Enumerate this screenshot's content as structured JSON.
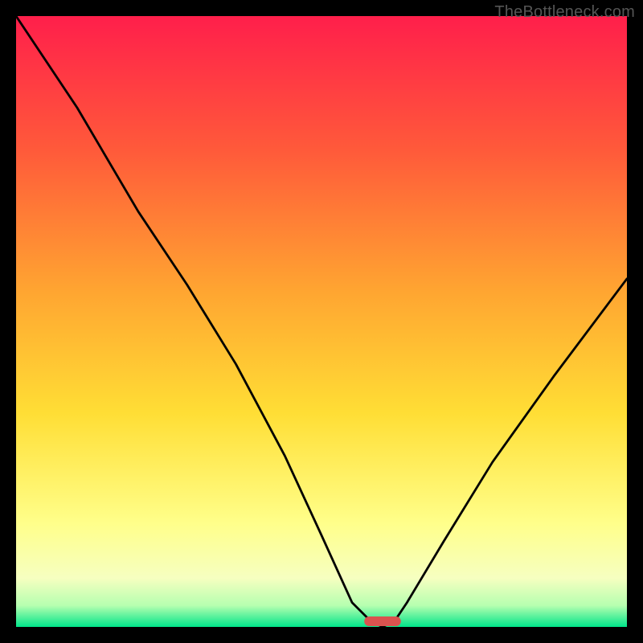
{
  "watermark": "TheBottleneck.com",
  "chart_data": {
    "type": "line",
    "title": "",
    "xlabel": "",
    "ylabel": "",
    "xlim": [
      0,
      100
    ],
    "ylim": [
      0,
      100
    ],
    "legend": [],
    "grid": false,
    "annotations": [],
    "series": [
      {
        "name": "bottleneck-curve",
        "x": [
          0,
          10,
          20,
          28,
          36,
          44,
          50,
          55,
          58,
          60,
          62,
          64,
          70,
          78,
          88,
          100
        ],
        "values": [
          100,
          85,
          68,
          56,
          43,
          28,
          15,
          4,
          1,
          0,
          1,
          4,
          14,
          27,
          41,
          57
        ]
      }
    ],
    "marker": {
      "name": "optimal-marker",
      "x": 60,
      "width": 6,
      "color": "#d9534f"
    },
    "background_gradient": {
      "stops": [
        {
          "pos": 0.0,
          "color": "#ff1f4b"
        },
        {
          "pos": 0.22,
          "color": "#ff5a3a"
        },
        {
          "pos": 0.45,
          "color": "#ffa531"
        },
        {
          "pos": 0.65,
          "color": "#ffde35"
        },
        {
          "pos": 0.83,
          "color": "#ffff8a"
        },
        {
          "pos": 0.92,
          "color": "#f6ffc0"
        },
        {
          "pos": 0.965,
          "color": "#b6ffb0"
        },
        {
          "pos": 1.0,
          "color": "#00e58a"
        }
      ]
    }
  }
}
